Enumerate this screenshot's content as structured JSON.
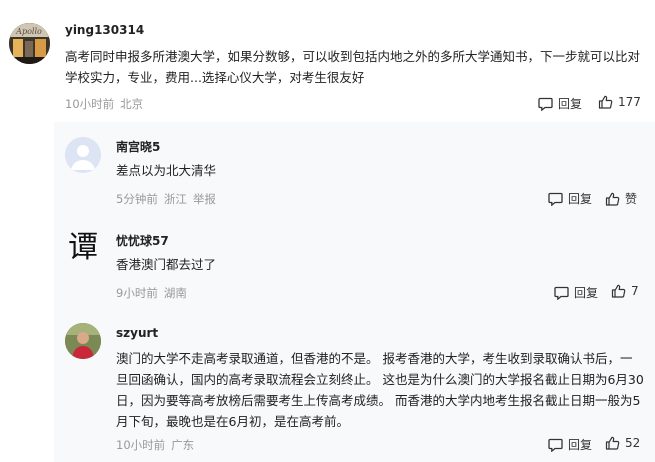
{
  "main_comment": {
    "username": "ying130314",
    "text": "高考同时申报多所港澳大学，如果分数够，可以收到包括内地之外的多所大学通知书，下一步就可以比对学校实力，专业，费用...选择心仪大学，对考生很友好",
    "time": "10小时前",
    "location": "北京",
    "reply_label": "回复",
    "like_count": "177"
  },
  "replies": [
    {
      "username": "南宫晓5",
      "text": "差点以为北大清华",
      "time": "5分钟前",
      "location": "浙江",
      "report_label": "举报",
      "reply_label": "回复",
      "like_label": "赞"
    },
    {
      "username": "忧忧球57",
      "avatar_char": "谭",
      "text": "香港澳门都去过了",
      "time": "9小时前",
      "location": "湖南",
      "reply_label": "回复",
      "like_count": "7"
    },
    {
      "username": "szyurt",
      "text": "澳门的大学不走高考录取通道，但香港的不是。 报考香港的大学，考生收到录取确认书后，一旦回函确认，国内的高考录取流程会立刻终止。 这也是为什么澳门的大学报名截止日期为6月30日，因为要等高考放榜后需要考生上传高考成绩。 而香港的大学内地考生报名截止日期一般为5月下旬，最晚也是在6月初，是在高考前。",
      "time": "10小时前",
      "location": "广东",
      "reply_label": "回复",
      "like_count": "52"
    }
  ],
  "colors": {
    "panel_bg": "#f8f9fa",
    "meta_gray": "#999999",
    "text": "#222222"
  },
  "icons": [
    "comment-icon",
    "thumbs-up-icon"
  ]
}
